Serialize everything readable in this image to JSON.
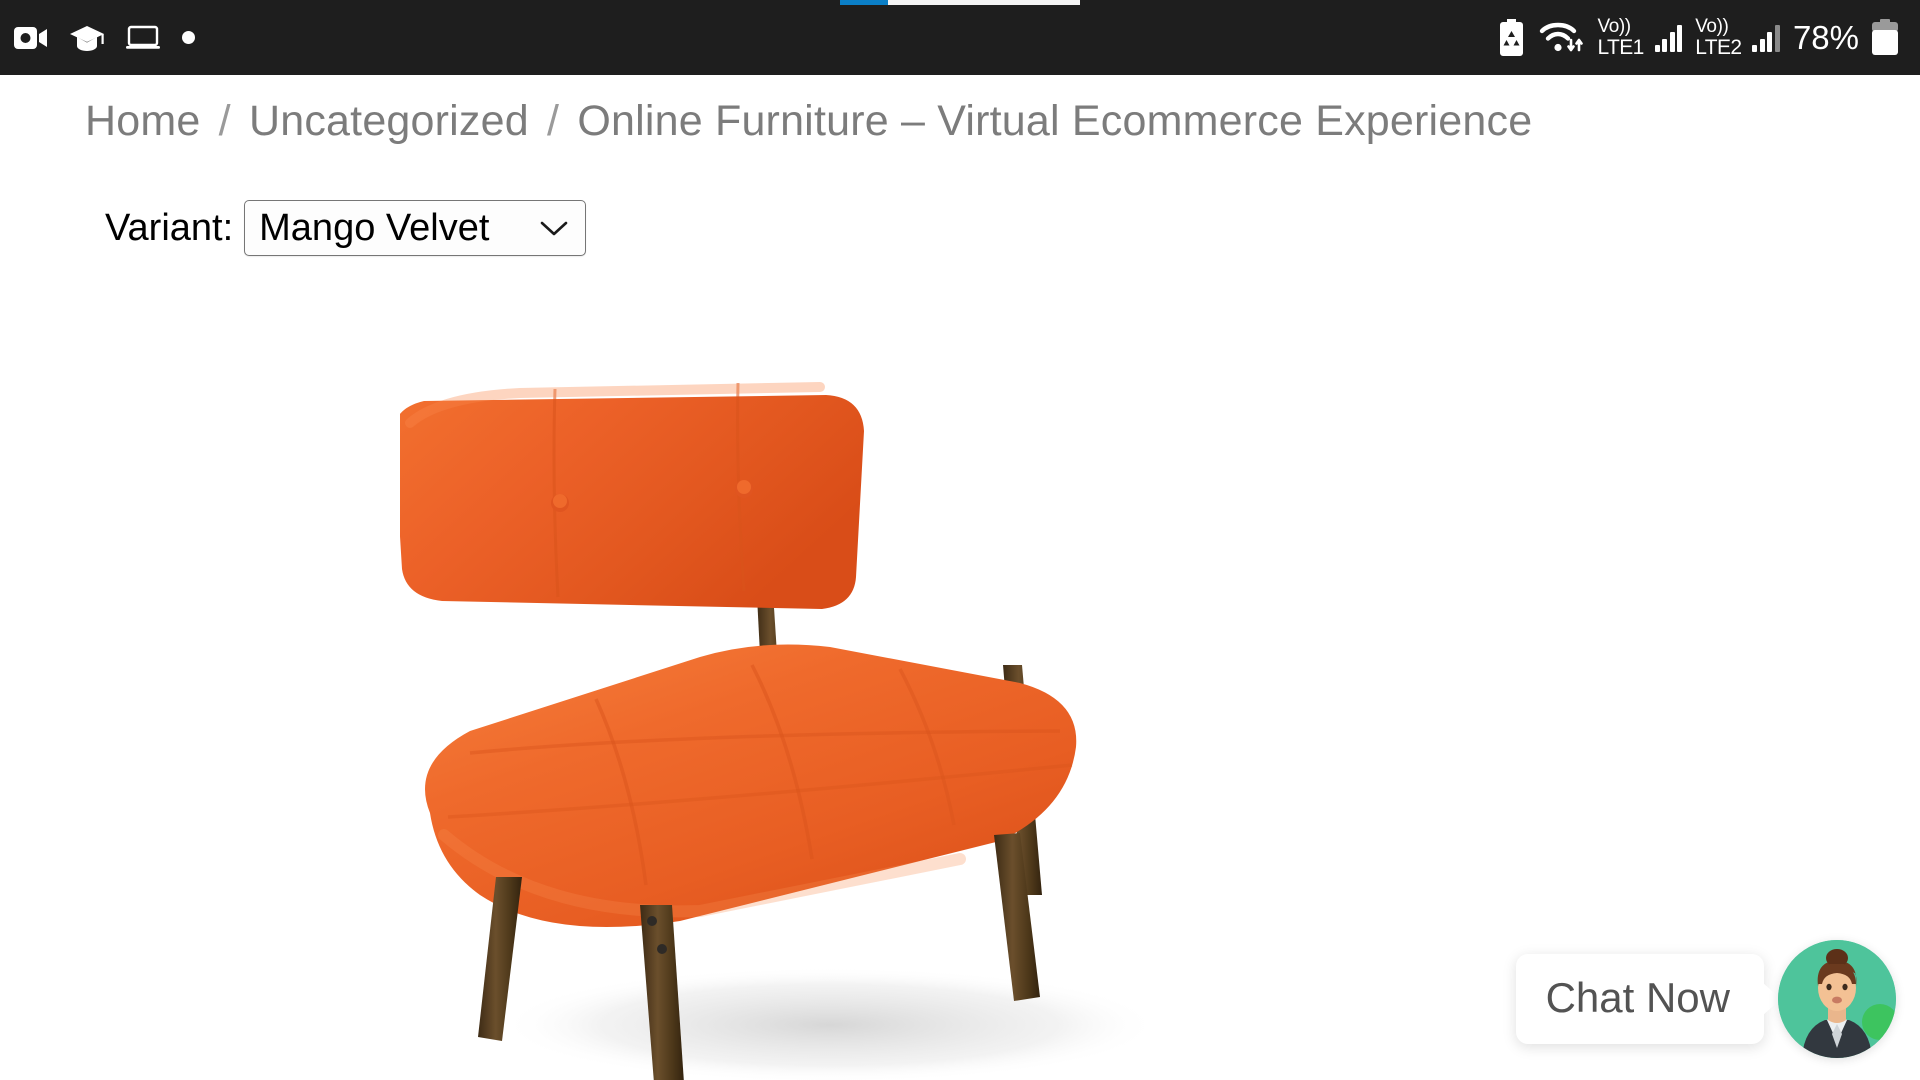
{
  "status_bar": {
    "background_color": "#1e1e1e",
    "left_icons": [
      {
        "name": "video-camera-icon",
        "label": "Screen recorder"
      },
      {
        "name": "graduation-cap-icon",
        "label": "Education app"
      },
      {
        "name": "laptop-icon",
        "label": "Desktop mode"
      },
      {
        "name": "notification-dot-icon",
        "label": "Notification"
      }
    ],
    "right_icons": [
      {
        "name": "battery-saver-icon",
        "label": "Battery saver"
      },
      {
        "name": "wifi-icon",
        "label": "Wi-Fi"
      }
    ],
    "sim1": {
      "network_label_top": "Vo))",
      "network_label_bottom": "LTE1",
      "signal_bars": 4
    },
    "sim2": {
      "network_label_top": "Vo))",
      "network_label_bottom": "LTE2",
      "signal_bars": 3
    },
    "battery_percent": "78%"
  },
  "progress": {
    "value_percent": 20,
    "fill_color": "#0b7fc7",
    "track_color": "#f4f4f4"
  },
  "breadcrumb": {
    "items": [
      "Home",
      "Uncategorized",
      "Online Furniture – Virtual Ecommerce Experience"
    ],
    "separator": "/",
    "text_color": "#7c7c7c"
  },
  "variant": {
    "label": "Variant:",
    "selected": "Mango Velvet",
    "options": [
      "Mango Velvet"
    ],
    "chevron_icon": "chevron-down-icon"
  },
  "product": {
    "name": "Online Furniture – Virtual Ecommerce Experience",
    "image_alt": "Orange mango velvet tufted accent chair with dark wooden legs",
    "upholstery_color": "#e8612a",
    "leg_color": "#5c4428"
  },
  "chat_widget": {
    "bubble_label": "Chat Now",
    "avatar_name": "support-agent-avatar",
    "avatar_background_color": "#4ec49b",
    "online_status_color": "#3dc45f",
    "online": true
  }
}
